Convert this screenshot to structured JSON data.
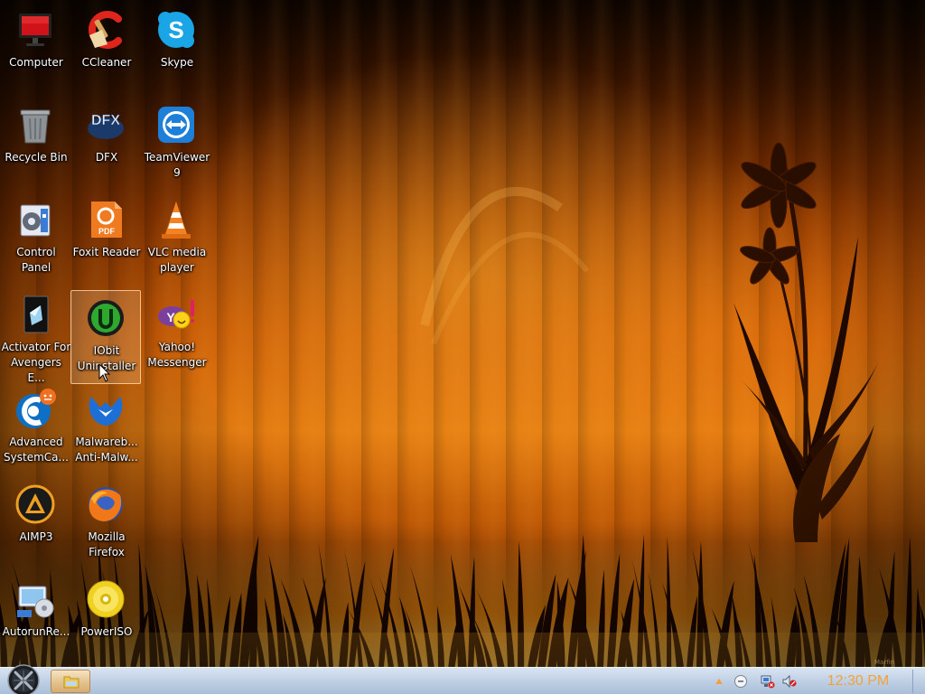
{
  "desktop": {
    "icons": [
      {
        "label": "Computer",
        "icon": "computer-icon"
      },
      {
        "label": "CCleaner",
        "icon": "ccleaner-icon"
      },
      {
        "label": "Skype",
        "icon": "skype-icon"
      },
      {
        "label": "Recycle Bin",
        "icon": "recycle-bin-icon"
      },
      {
        "label": "DFX",
        "icon": "dfx-icon"
      },
      {
        "label": "TeamViewer 9",
        "icon": "teamviewer-icon"
      },
      {
        "label": "Control Panel",
        "icon": "control-panel-icon"
      },
      {
        "label": "Foxit Reader",
        "icon": "foxit-reader-icon"
      },
      {
        "label": "VLC media player",
        "icon": "vlc-icon"
      },
      {
        "label": "Activator For Avengers E...",
        "icon": "activator-icon"
      },
      {
        "label": "IObit Uninstaller",
        "icon": "iobit-uninstaller-icon",
        "selected": true
      },
      {
        "label": "Yahoo! Messenger",
        "icon": "yahoo-messenger-icon"
      },
      {
        "label": "Advanced SystemCa...",
        "icon": "advanced-systemcare-icon"
      },
      {
        "label": "Malwareb... Anti-Malw...",
        "icon": "malwarebytes-icon"
      },
      {
        "label": "AIMP3",
        "icon": "aimp3-icon"
      },
      {
        "label": "Mozilla Firefox",
        "icon": "firefox-icon"
      },
      {
        "label": "AutorunRe...",
        "icon": "autorun-icon"
      },
      {
        "label": "PowerISO",
        "icon": "poweriso-icon"
      }
    ]
  },
  "taskbar": {
    "clock": "12:30 PM",
    "pinned": [
      {
        "icon": "file-explorer-icon"
      }
    ],
    "tray": [
      "show-hidden-icons-arrow-icon",
      "chat-icon",
      "network-icon",
      "volume-muted-icon"
    ]
  },
  "wallpaper": {
    "watermark": "Marfin Firoh.com"
  },
  "colors": {
    "clock": "#f2a23a",
    "taskbar": "#c2d2e6",
    "wallpaper": "#e27a10"
  }
}
